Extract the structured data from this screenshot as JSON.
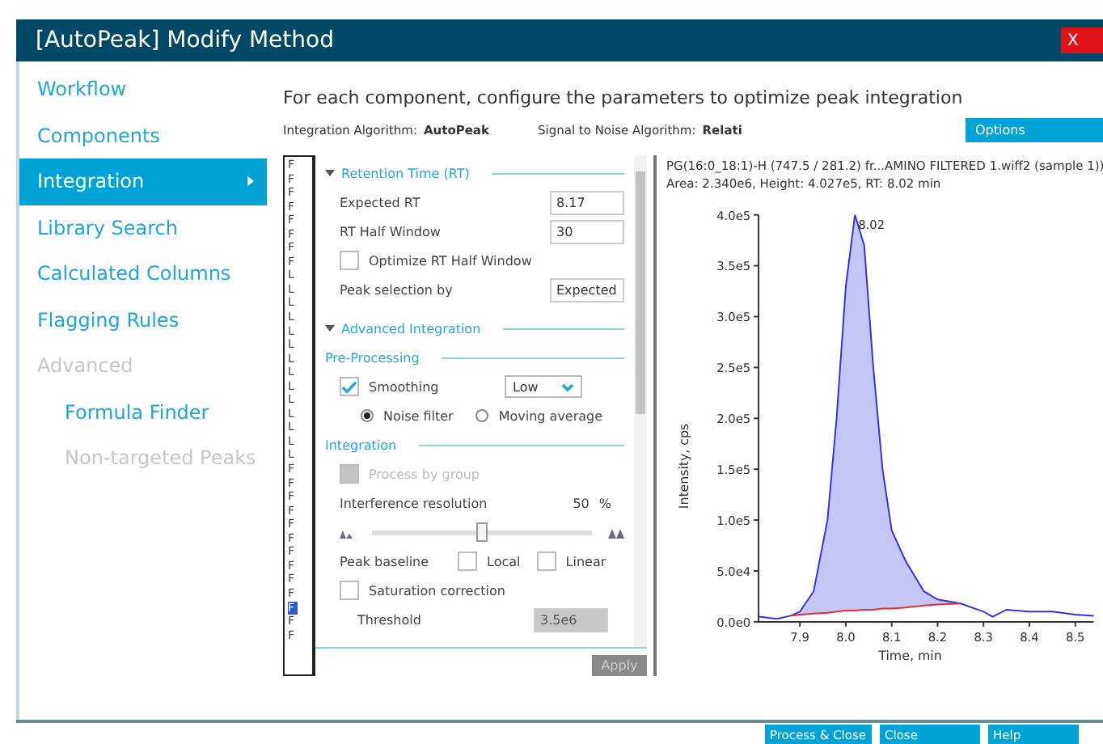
{
  "window": {
    "title": "[AutoPeak] Modify Method",
    "close": "X"
  },
  "sidebar": {
    "items": [
      {
        "label": "Workflow",
        "selected": false,
        "disabled": false
      },
      {
        "label": "Components",
        "selected": false,
        "disabled": false
      },
      {
        "label": "Integration",
        "selected": true,
        "disabled": false
      },
      {
        "label": "Library Search",
        "selected": false,
        "disabled": false
      },
      {
        "label": "Calculated Columns",
        "selected": false,
        "disabled": false
      },
      {
        "label": "Flagging Rules",
        "selected": false,
        "disabled": false
      },
      {
        "label": "Advanced",
        "selected": false,
        "disabled": true,
        "children": [
          {
            "label": "Formula Finder",
            "selected": false,
            "disabled": false
          },
          {
            "label": "Non-targeted Peaks",
            "selected": false,
            "disabled": true
          }
        ]
      }
    ]
  },
  "header": {
    "instruction": "For each component, configure the parameters to optimize peak integration",
    "integration_algorithm": {
      "label": "Integration Algorithm:",
      "value": "AutoPeak"
    },
    "signal_to_noise": {
      "label": "Signal to Noise Algorithm:",
      "value": "Relati"
    },
    "options_button": "Options"
  },
  "component_list": [
    {
      "label": "F",
      "selected": false
    },
    {
      "label": "F",
      "selected": false
    },
    {
      "label": "F",
      "selected": false
    },
    {
      "label": "F",
      "selected": false
    },
    {
      "label": "F",
      "selected": false
    },
    {
      "label": "F",
      "selected": false
    },
    {
      "label": "F",
      "selected": false
    },
    {
      "label": "F",
      "selected": false
    },
    {
      "label": "L",
      "selected": false
    },
    {
      "label": "L",
      "selected": false
    },
    {
      "label": "L",
      "selected": false
    },
    {
      "label": "L",
      "selected": false
    },
    {
      "label": "L",
      "selected": false
    },
    {
      "label": "L",
      "selected": false
    },
    {
      "label": "L",
      "selected": false
    },
    {
      "label": "L",
      "selected": false
    },
    {
      "label": "L",
      "selected": false
    },
    {
      "label": "L",
      "selected": false
    },
    {
      "label": "L",
      "selected": false
    },
    {
      "label": "L",
      "selected": false
    },
    {
      "label": "L",
      "selected": false
    },
    {
      "label": "L",
      "selected": false
    },
    {
      "label": "F",
      "selected": false
    },
    {
      "label": "F",
      "selected": false
    },
    {
      "label": "F",
      "selected": false
    },
    {
      "label": "F",
      "selected": false
    },
    {
      "label": "F",
      "selected": false
    },
    {
      "label": "F",
      "selected": false
    },
    {
      "label": "F",
      "selected": false
    },
    {
      "label": "F",
      "selected": false
    },
    {
      "label": "F",
      "selected": false
    },
    {
      "label": "F",
      "selected": false
    },
    {
      "label": "F",
      "selected": true
    },
    {
      "label": "F",
      "selected": false
    },
    {
      "label": "F",
      "selected": false
    }
  ],
  "retention_time": {
    "title": "Retention Time (RT)",
    "expanded": true,
    "expected_rt": {
      "label": "Expected RT",
      "value": "8.17"
    },
    "rt_half_window": {
      "label": "RT Half Window",
      "value": "30"
    },
    "optimize_rt_half_window": {
      "label": "Optimize RT Half Window",
      "checked": false
    },
    "peak_selection": {
      "label": "Peak selection by",
      "value": "Expected"
    }
  },
  "advanced_integration": {
    "title": "Advanced Integration",
    "expanded": true,
    "pre_processing": {
      "title": "Pre-Processing",
      "smoothing": {
        "label": "Smoothing",
        "checked": true,
        "value": "Low"
      },
      "methods": [
        {
          "label": "Noise filter",
          "selected": true
        },
        {
          "label": "Moving average",
          "selected": false
        }
      ]
    },
    "integration": {
      "title": "Integration",
      "process_by_group": {
        "label": "Process by group",
        "checked": false,
        "disabled": true
      },
      "interference_resolution": {
        "label": "Interference resolution",
        "reading": "50",
        "unit": "%",
        "level": 0.5
      },
      "peak_baseline": {
        "label": "Peak baseline",
        "options": [
          {
            "label": "Local",
            "checked": false
          },
          {
            "label": "Linear",
            "checked": false
          }
        ]
      },
      "saturation_correction": {
        "label": "Saturation correction",
        "checked": false
      },
      "threshold": {
        "label": "Threshold",
        "value": "3.5e6",
        "disabled": true
      }
    }
  },
  "apply_button": {
    "label": "Apply",
    "disabled": true
  },
  "chart": {
    "title": "PG(16:0_18:1)-H (747.5 / 281.2) fr...AMINO FILTERED 1.wiff2 (sample 1))",
    "summary": "Area: 2.340e6, Height: 4.027e5, RT: 8.02 min",
    "chart_data": {
      "type": "line",
      "xlabel": "Time, min",
      "ylabel": "Intensity, cps",
      "x": [
        7.81,
        7.85,
        7.88,
        7.9,
        7.93,
        7.96,
        7.98,
        8.0,
        8.02,
        8.04,
        8.06,
        8.08,
        8.1,
        8.13,
        8.17,
        8.2,
        8.25,
        8.3,
        8.32,
        8.35,
        8.4,
        8.45,
        8.5,
        8.54
      ],
      "series": [
        {
          "color": "#3333dd",
          "values": [
            5000,
            3000,
            6000,
            10000,
            30000,
            100000,
            200000,
            330000,
            400000,
            370000,
            250000,
            150000,
            90000,
            60000,
            30000,
            22000,
            18000,
            10000,
            5000,
            12000,
            10000,
            10000,
            7000,
            6000
          ]
        },
        {
          "color": "#e03030",
          "values": [
            null,
            null,
            6000,
            7000,
            8000,
            9000,
            10000,
            11000,
            11000,
            12000,
            12000,
            13000,
            13000,
            14000,
            16000,
            17000,
            18000,
            null,
            null,
            null,
            null,
            null,
            null,
            null
          ]
        }
      ],
      "xlim": [
        7.81,
        8.54
      ],
      "ylim": [
        0,
        400000
      ],
      "xticks": [
        7.9,
        {
          "value": 8,
          "label": "8.0"
        },
        8.1,
        8.2,
        8.3,
        8.4,
        8.5
      ],
      "yticks": [
        {
          "value": 0,
          "label": "0.0e0"
        },
        {
          "value": 50000,
          "label": "5.0e4"
        },
        {
          "value": 100000,
          "label": "1.0e5"
        },
        {
          "value": 150000,
          "label": "1.5e5"
        },
        {
          "value": 200000,
          "label": "2.0e5"
        },
        {
          "value": 250000,
          "label": "2.5e5"
        },
        {
          "value": 300000,
          "label": "3.0e5"
        },
        {
          "value": 350000,
          "label": "3.5e5"
        },
        {
          "value": 400000,
          "label": "4.0e5"
        }
      ],
      "annotations": [
        {
          "x": 8.02,
          "y": 400000,
          "text": "8.02"
        }
      ]
    }
  },
  "footer_buttons": [
    "Process & Close",
    "Close",
    "Help"
  ]
}
